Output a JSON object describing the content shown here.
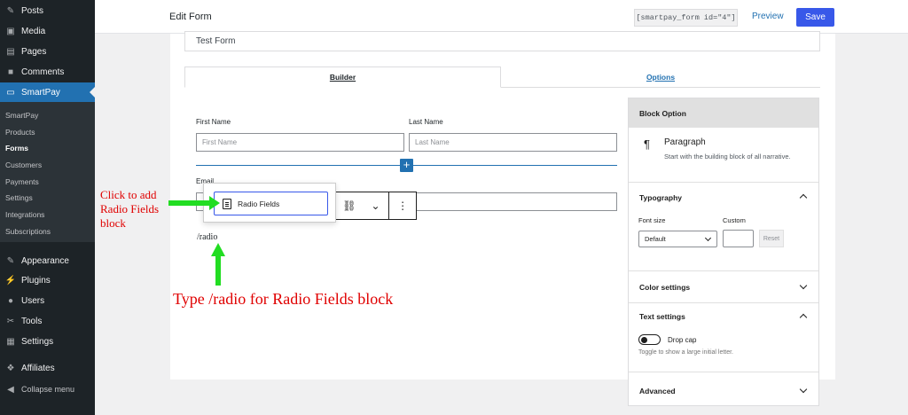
{
  "sidebar": {
    "top_items": [
      {
        "label": "Posts",
        "icon": "pin-icon"
      },
      {
        "label": "Media",
        "icon": "media-icon"
      },
      {
        "label": "Pages",
        "icon": "pages-icon"
      },
      {
        "label": "Comments",
        "icon": "comments-icon"
      },
      {
        "label": "SmartPay",
        "icon": "smartpay-icon"
      }
    ],
    "submenu": [
      "SmartPay",
      "Products",
      "Forms",
      "Customers",
      "Payments",
      "Settings",
      "Integrations",
      "Subscriptions"
    ],
    "submenu_current": "Forms",
    "bottom_items": [
      {
        "label": "Appearance",
        "icon": "appearance-icon"
      },
      {
        "label": "Plugins",
        "icon": "plugins-icon"
      },
      {
        "label": "Users",
        "icon": "users-icon"
      },
      {
        "label": "Tools",
        "icon": "tools-icon"
      },
      {
        "label": "Settings",
        "icon": "settings-icon"
      },
      {
        "label": "Affiliates",
        "icon": "affiliates-icon"
      },
      {
        "label": "Collapse menu",
        "icon": "collapse-icon"
      }
    ]
  },
  "header": {
    "title": "Edit Form",
    "shortcode": "[smartpay_form id=\"4\"]",
    "preview": "Preview",
    "save": "Save"
  },
  "form": {
    "title_value": "Test Form",
    "tabs": [
      "Builder",
      "Options"
    ],
    "first_name_label": "First Name",
    "first_name_placeholder": "First Name",
    "last_name_label": "Last Name",
    "last_name_placeholder": "Last Name",
    "email_label": "Email",
    "slash_command": "/radio"
  },
  "inserter": {
    "item_label": "Radio Fields"
  },
  "annotations": {
    "click_hint": "Click to add Radio Fields block",
    "type_hint": "Type /radio for Radio Fields block",
    "color": "#e00000",
    "arrow_color": "#22dd22"
  },
  "block_panel": {
    "header": "Block Option",
    "block_name": "Paragraph",
    "block_desc": "Start with the building block of all narrative.",
    "typography": "Typography",
    "font_size_label": "Font size",
    "font_size_value": "Default",
    "custom_label": "Custom",
    "reset": "Reset",
    "color_settings": "Color settings",
    "text_settings": "Text settings",
    "drop_cap": "Drop cap",
    "drop_cap_help": "Toggle to show a large initial letter.",
    "advanced": "Advanced"
  },
  "colors": {
    "accent": "#2271b1",
    "save": "#3858e9",
    "sidebar": "#1d2327"
  }
}
